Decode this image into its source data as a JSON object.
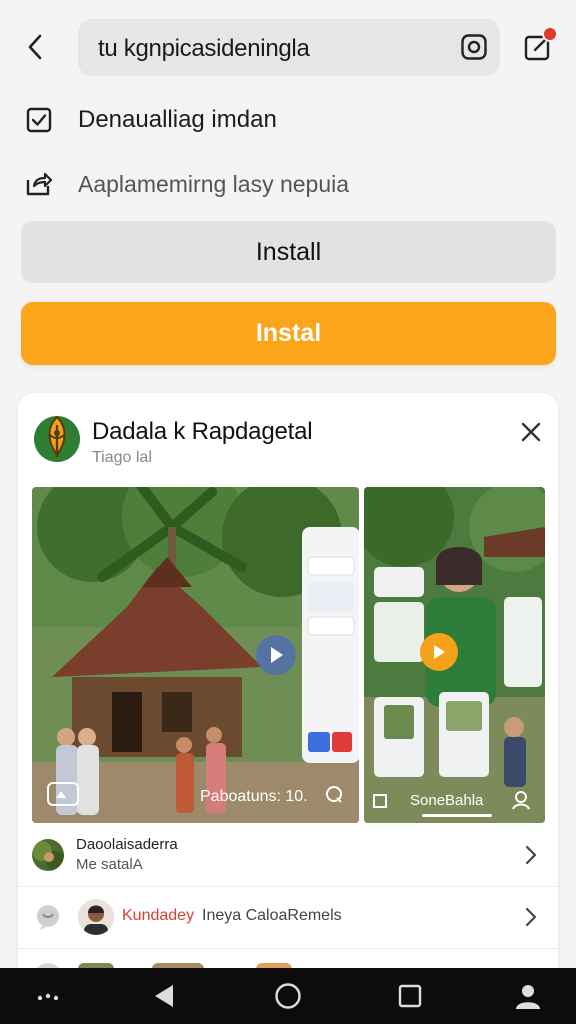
{
  "header": {
    "search_query": "tu kgnpicasideningla",
    "back_icon": "back-arrow-icon",
    "camera_icon": "camera-icon",
    "edit_icon": "edit-compose-icon",
    "notification_color": "#e2372b"
  },
  "options": [
    {
      "icon": "checkbox-icon",
      "label": "Denaualliag imdan"
    },
    {
      "icon": "share-icon",
      "label": "Aaplamemirng lasy nepuia"
    }
  ],
  "buttons": {
    "secondary_label": "Install",
    "primary_label": "Instal",
    "primary_color": "#fba51a",
    "secondary_color": "#e2e2e4"
  },
  "card": {
    "title": "Dadala k Rapdagetal",
    "subtitle": "Tiago lal",
    "logo_icon": "leaf-emblem-logo",
    "close_icon": "close-icon",
    "media": {
      "left_caption": "Paboatuns: 10.",
      "right_caption": "SoneBahla",
      "play_icon": "play-icon"
    },
    "rows": [
      {
        "title": "Daoolaisaderra",
        "subtitle": "Me satalA"
      },
      {
        "highlight": "Kundadey",
        "text": "Ineya CaloaRemels"
      },
      {
        "highlight": "",
        "text": ""
      }
    ]
  },
  "navbar": {
    "items": [
      "menu-dots-icon",
      "back-triangle-icon",
      "home-circle-icon",
      "recents-square-icon",
      "profile-icon"
    ]
  }
}
